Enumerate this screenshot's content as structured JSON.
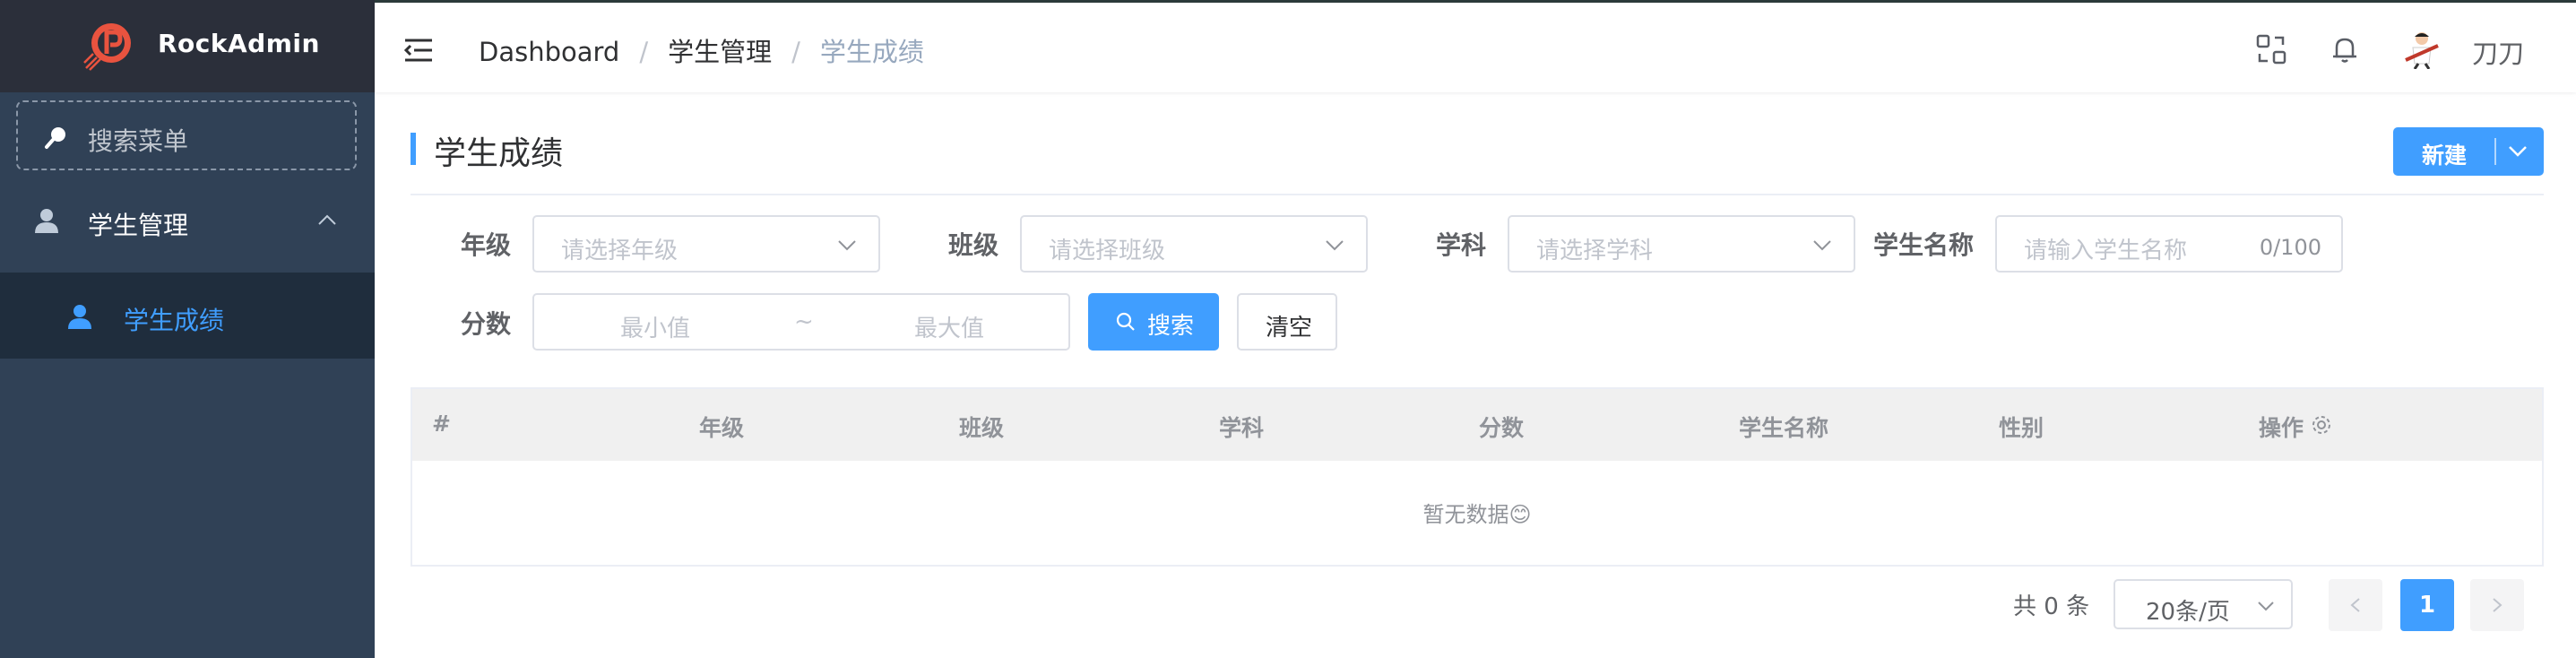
{
  "app": {
    "name": "RockAdmin"
  },
  "sidebar": {
    "search_placeholder": "搜索菜单",
    "groups": [
      {
        "label": "学生管理",
        "expanded": true,
        "icon": "user-icon",
        "items": [
          {
            "label": "学生成绩",
            "active": true,
            "icon": "user-icon"
          }
        ]
      }
    ]
  },
  "header": {
    "breadcrumb": [
      "Dashboard",
      "学生管理",
      "学生成绩"
    ],
    "breadcrumb_sep": "/",
    "username": "刀刀"
  },
  "page": {
    "title": "学生成绩",
    "new_button": "新建"
  },
  "filters": {
    "grade": {
      "label": "年级",
      "placeholder": "请选择年级"
    },
    "class": {
      "label": "班级",
      "placeholder": "请选择班级"
    },
    "subject": {
      "label": "学科",
      "placeholder": "请选择学科"
    },
    "student_name": {
      "label": "学生名称",
      "placeholder": "请输入学生名称",
      "counter": "0/100"
    },
    "score": {
      "label": "分数",
      "min_placeholder": "最小值",
      "separator": "~",
      "max_placeholder": "最大值"
    },
    "search_button": "搜索",
    "clear_button": "清空"
  },
  "table": {
    "columns": [
      "#",
      "年级",
      "班级",
      "学科",
      "分数",
      "学生名称",
      "性别",
      "操作"
    ],
    "rows": [],
    "empty_text": "暂无数据😊"
  },
  "pagination": {
    "total_text": "共 0 条",
    "page_size": "20条/页",
    "current_page": "1"
  },
  "colors": {
    "primary": "#409eff",
    "sidebar_bg": "#304156",
    "logo_bg": "#2b2f3a",
    "submenu_bg": "#1f2d3d"
  }
}
